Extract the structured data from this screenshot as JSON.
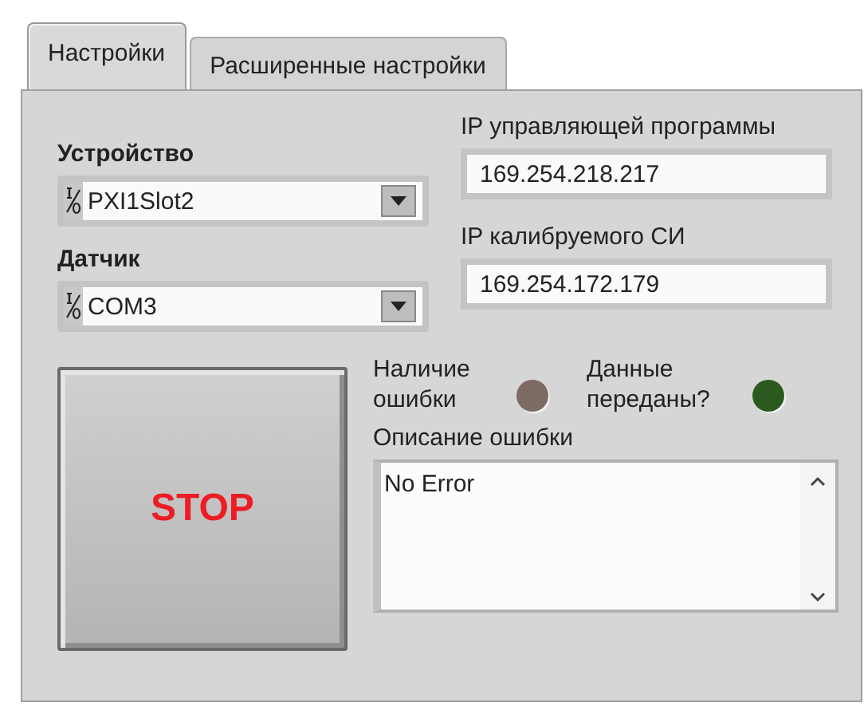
{
  "tabs": [
    {
      "label": "Настройки",
      "selected": true
    },
    {
      "label": "Расширенные настройки",
      "selected": false
    }
  ],
  "device": {
    "label": "Устройство",
    "value": "PXI1Slot2"
  },
  "sensor": {
    "label": "Датчик",
    "value": "COM3"
  },
  "control_ip": {
    "label": "IP управляющей программы",
    "value": "169.254.218.217"
  },
  "calibrated_ip": {
    "label": "IP калибруемого СИ",
    "value": "169.254.172.179"
  },
  "stop_button": {
    "label": "STOP"
  },
  "indicators": [
    {
      "label": "Наличие ошибки",
      "color": "#7d6a62"
    },
    {
      "label": "Данные переданы?",
      "color": "#2c5a1e"
    }
  ],
  "error_description": {
    "label": "Описание ошибки",
    "value": "No Error"
  }
}
